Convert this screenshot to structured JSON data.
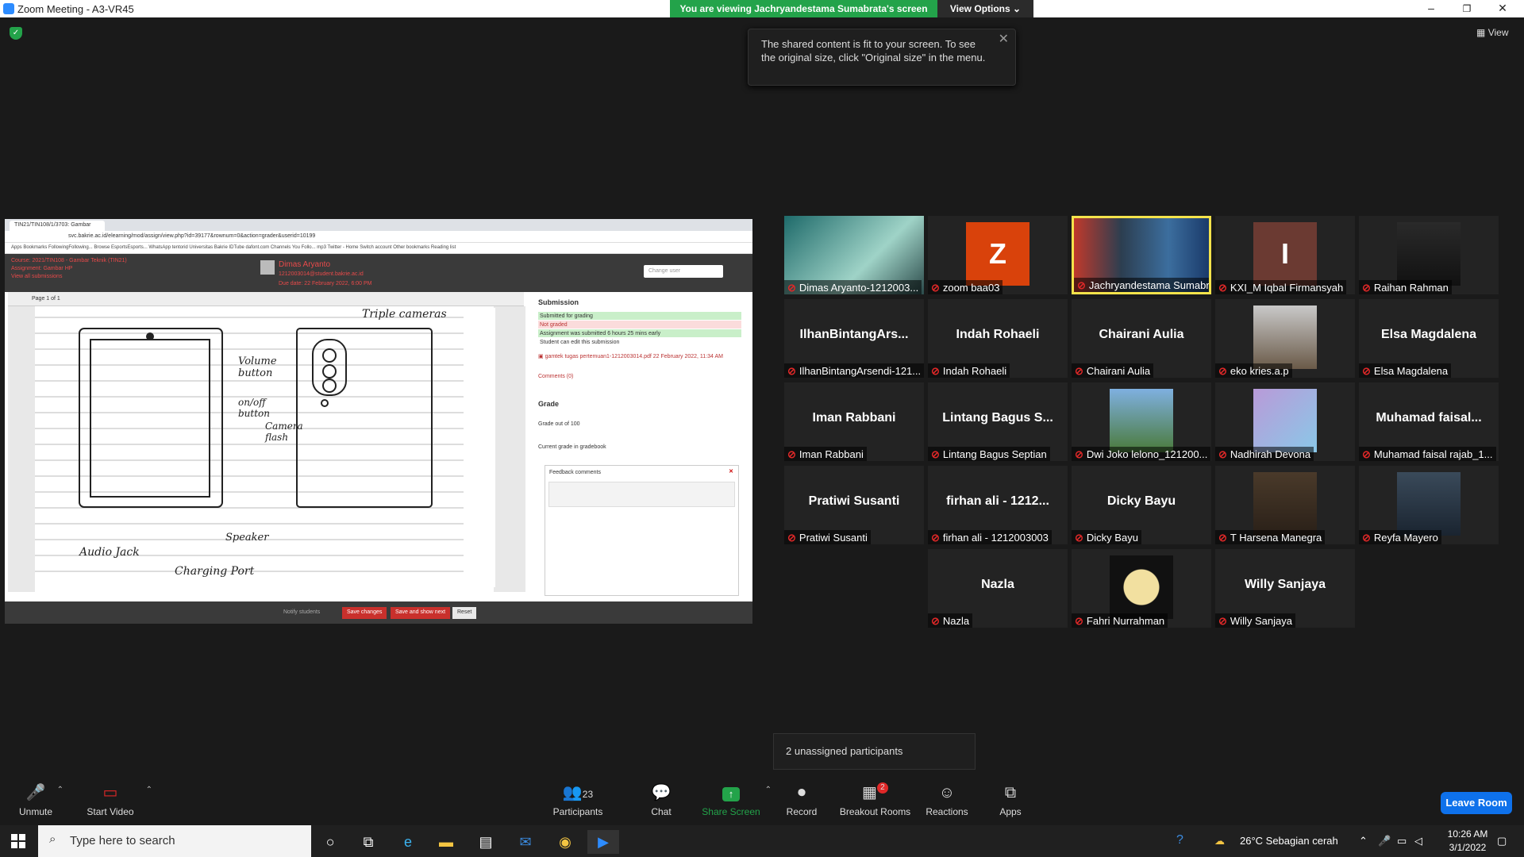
{
  "window": {
    "title": "Zoom Meeting - A3-VR45",
    "banner": "You are viewing Jachryandestama Sumabrata's screen",
    "view_options": "View Options",
    "view_label": "View",
    "min": "–",
    "max": "❐",
    "close": "✕"
  },
  "tooltip": {
    "text": "The shared content is fit to your screen. To see the original size, click \"Original size\" in the menu.",
    "close": "✕"
  },
  "shared": {
    "tab": "TIN21/TIN108/1/3703: Gambar",
    "url": "svc.bakrie.ac.id/elearning/mod/assign/view.php?id=39177&rownum=0&action=grader&userid=10199",
    "bookmarks": "Apps   Bookmarks   FollowingFollowing...   Browse   EsportsEsports...   WhatsApp   tentorid   Universitas Bakrie   IDTube   dafont.com   Channels You Follo...   mp3   Twitter - Home   Switch account        Other bookmarks   Reading list",
    "course": "Course: 2021/TIN108 - Gambar Teknik (TIN21)",
    "assignment": "Assignment: Gambar HP",
    "view_all": "View all submissions",
    "student_name": "Dimas Aryanto",
    "student_email": "1212003014@student.bakrie.ac.id",
    "due": "Due date: 22 February 2022, 6:00 PM",
    "change_user": "Change user",
    "page": "Page 1 of 1",
    "submission_title": "Submission",
    "status": [
      "Submitted for grading",
      "Not graded",
      "Assignment was submitted 6 hours 25 mins early",
      "Student can edit this submission"
    ],
    "file": "gamtek tugas pertemuan1-1212003014.pdf",
    "file_date": "22 February 2022, 11:34 AM",
    "comments": "Comments (0)",
    "grade_title": "Grade",
    "grade_out_of": "Grade out of 100",
    "current_grade": "Current grade in gradebook",
    "feedback": "Feedback comments",
    "notify": "Notify students",
    "save": "Save changes",
    "save_next": "Save and show next",
    "reset": "Reset",
    "drawing_labels": {
      "volume": "Volume button",
      "onoff": "on/off button",
      "camera": "Camera flash",
      "triple": "Triple cameras",
      "speaker": "Speaker",
      "audio": "Audio Jack",
      "charging": "Charging Port"
    }
  },
  "participants": [
    {
      "name": "Dimas Aryanto-1212003...",
      "big": "",
      "photo": "full-teal"
    },
    {
      "name": "zoom baa03",
      "big": "",
      "letter": "Z",
      "lettercolor": "#d9420b"
    },
    {
      "name": "Jachryandestama Sumabrata",
      "big": "",
      "photo": "full-city",
      "active": true
    },
    {
      "name": "KXI_M Iqbal Firmansyah",
      "big": "",
      "letter": "I",
      "lettercolor": "#6b3a32"
    },
    {
      "name": "Raihan Rahman",
      "big": "",
      "photo": "dark"
    },
    {
      "name": "IlhanBintangArsendi-121...",
      "big": "IlhanBintangArs..."
    },
    {
      "name": "Indah Rohaeli",
      "big": "Indah Rohaeli"
    },
    {
      "name": "Chairani Aulia",
      "big": "Chairani Aulia"
    },
    {
      "name": "eko kries.a.p",
      "big": "",
      "photo": "beach"
    },
    {
      "name": "Elsa Magdalena",
      "big": "Elsa Magdalena"
    },
    {
      "name": "Iman Rabbani",
      "big": "Iman Rabbani"
    },
    {
      "name": "Lintang Bagus Septian",
      "big": "Lintang Bagus S..."
    },
    {
      "name": "Dwi Joko lelono_121200...",
      "big": "",
      "photo": "park"
    },
    {
      "name": "Nadhirah Devona",
      "big": "",
      "photo": "purple"
    },
    {
      "name": "Muhamad faisal rajab_1...",
      "big": "Muhamad  faisal..."
    },
    {
      "name": "Pratiwi Susanti",
      "big": "Pratiwi Susanti"
    },
    {
      "name": "firhan ali - 1212003003",
      "big": "firhan ali - 1212..."
    },
    {
      "name": "Dicky Bayu",
      "big": "Dicky Bayu"
    },
    {
      "name": "T Harsena Manegra",
      "big": "",
      "photo": "cafe"
    },
    {
      "name": "Reyfa Mayero",
      "big": "",
      "photo": "man"
    },
    {
      "name": "Nazla",
      "big": "Nazla"
    },
    {
      "name": "Fahri Nurrahman",
      "big": "",
      "photo": "cartoon"
    },
    {
      "name": "Willy Sanjaya",
      "big": "Willy Sanjaya"
    }
  ],
  "unassigned": "2 unassigned participants",
  "toolbar": {
    "unmute": "Unmute",
    "start_video": "Start Video",
    "participants": "Participants",
    "participants_count": "23",
    "chat": "Chat",
    "share": "Share Screen",
    "record": "Record",
    "breakout": "Breakout Rooms",
    "breakout_badge": "2",
    "reactions": "Reactions",
    "apps": "Apps",
    "leave": "Leave Room"
  },
  "taskbar": {
    "search": "Type here to search",
    "weather": "26°C  Sebagian cerah",
    "time": "10:26 AM",
    "date": "3/1/2022"
  },
  "colors": {
    "accent": "#0e71eb",
    "banner": "#23a34a",
    "active": "#f4e34b",
    "muted": "#e02828"
  }
}
